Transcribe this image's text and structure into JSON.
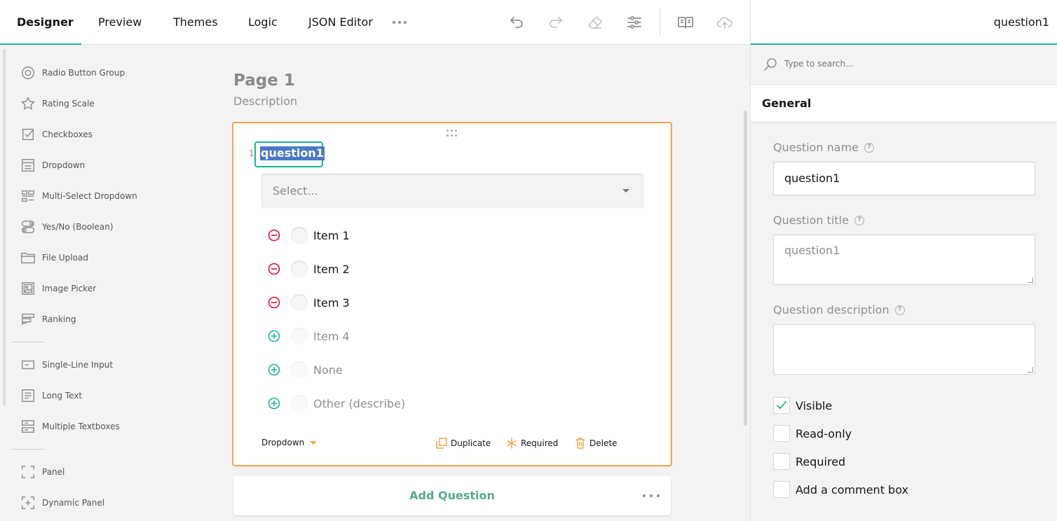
{
  "tabs": [
    {
      "label": "Designer",
      "active": true
    },
    {
      "label": "Preview"
    },
    {
      "label": "Themes"
    },
    {
      "label": "Logic"
    },
    {
      "label": "JSON Editor"
    }
  ],
  "toolbar_icons": [
    "undo-icon",
    "redo-icon",
    "eraser-icon",
    "settings-sliders-icon",
    "book-icon",
    "cloud-upload-icon"
  ],
  "toolbox": {
    "items": [
      {
        "label": "Radio Button Group",
        "icon": "radio-icon"
      },
      {
        "label": "Rating Scale",
        "icon": "star-icon"
      },
      {
        "label": "Checkboxes",
        "icon": "checkbox-icon"
      },
      {
        "label": "Dropdown",
        "icon": "dropdown-icon"
      },
      {
        "label": "Multi-Select Dropdown",
        "icon": "multi-select-icon"
      },
      {
        "label": "Yes/No (Boolean)",
        "icon": "toggle-icon"
      },
      {
        "label": "File Upload",
        "icon": "folder-icon"
      },
      {
        "label": "Image Picker",
        "icon": "image-icon"
      },
      {
        "label": "Ranking",
        "icon": "ranking-icon"
      },
      {
        "label": "Single-Line Input",
        "icon": "text-input-icon"
      },
      {
        "label": "Long Text",
        "icon": "long-text-icon"
      },
      {
        "label": "Multiple Textboxes",
        "icon": "multiple-text-icon"
      },
      {
        "label": "Panel",
        "icon": "panel-icon"
      },
      {
        "label": "Dynamic Panel",
        "icon": "dynamic-panel-icon"
      }
    ]
  },
  "page": {
    "title": "Page 1",
    "description": "Description"
  },
  "question": {
    "number": "1.",
    "title": "question1",
    "placeholder": "Select...",
    "choices": [
      {
        "text": "Item 1",
        "action": "remove"
      },
      {
        "text": "Item 2",
        "action": "remove"
      },
      {
        "text": "Item 3",
        "action": "remove"
      },
      {
        "text": "Item 4",
        "action": "add"
      },
      {
        "text": "None",
        "action": "add"
      },
      {
        "text": "Other (describe)",
        "action": "add"
      }
    ],
    "type_label": "Dropdown",
    "actions": {
      "duplicate": "Duplicate",
      "required": "Required",
      "delete": "Delete"
    }
  },
  "add_question": "Add Question",
  "property_grid": {
    "object_name": "question1",
    "search_placeholder": "Type to search...",
    "category": "General",
    "fields": {
      "name_label": "Question name",
      "name_value": "question1",
      "title_label": "Question title",
      "title_placeholder": "question1",
      "description_label": "Question description",
      "description_value": ""
    },
    "checks": [
      {
        "label": "Visible",
        "checked": true
      },
      {
        "label": "Read-only",
        "checked": false
      },
      {
        "label": "Required",
        "checked": false
      },
      {
        "label": "Add a comment box",
        "checked": false
      }
    ]
  },
  "colors": {
    "accent": "#19b394",
    "selection_border": "#f3a24c",
    "remove": "#e50a3e",
    "add": "#19b394"
  }
}
